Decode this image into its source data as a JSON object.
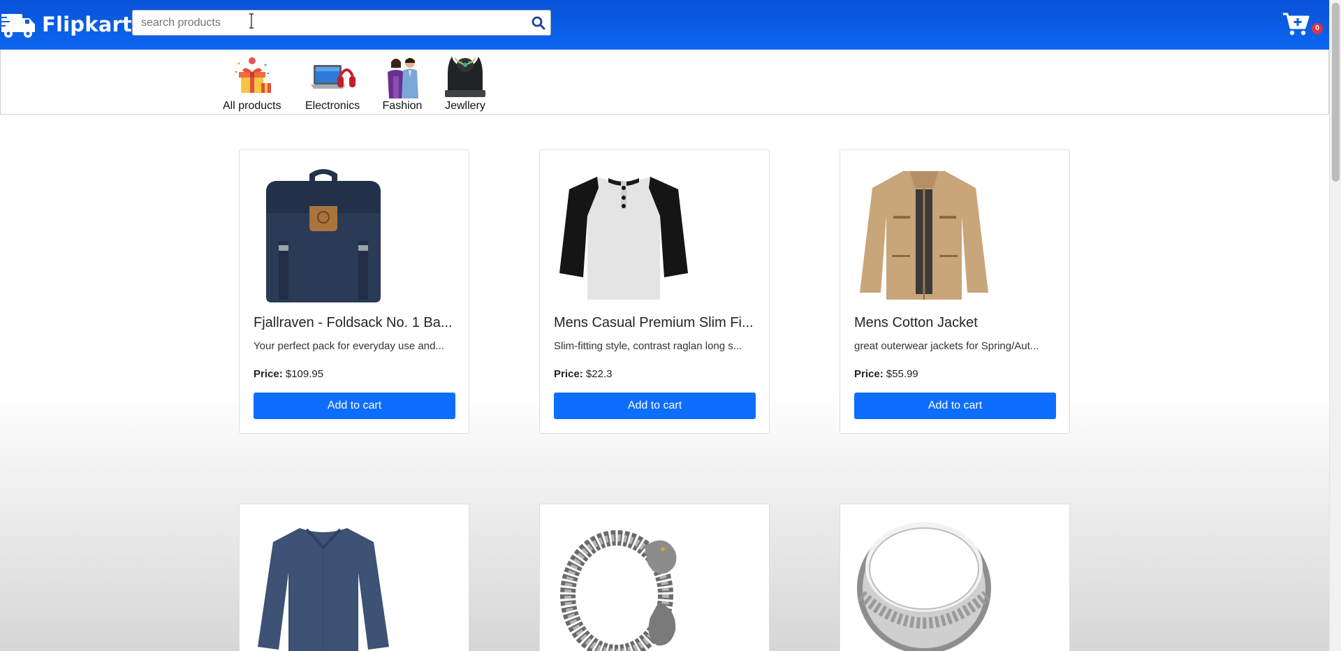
{
  "header": {
    "logo_text": "Flipkart",
    "search_placeholder": "search products",
    "cart_count": "0",
    "logo_icon": "truck-icon",
    "search_icon": "search-icon",
    "cart_icon": "cart-plus-icon"
  },
  "categories": [
    {
      "label": "All products",
      "icon": "gift-boxes-image"
    },
    {
      "label": "Electronics",
      "icon": "laptop-headphones-image"
    },
    {
      "label": "Fashion",
      "icon": "couple-fashion-image"
    },
    {
      "label": "Jewllery",
      "icon": "necklace-image"
    }
  ],
  "products": [
    {
      "title": "Fjallraven - Foldsack No. 1 Ba...",
      "desc": "Your perfect pack for everyday use and...",
      "price_label": "Price:",
      "price": "$109.95",
      "button": "Add to cart",
      "image": "backpack-image"
    },
    {
      "title": "Mens Casual Premium Slim Fi...",
      "desc": "Slim-fitting style, contrast raglan long s...",
      "price_label": "Price:",
      "price": "$22.3",
      "button": "Add to cart",
      "image": "raglan-tshirt-image"
    },
    {
      "title": "Mens Cotton Jacket",
      "desc": "great outerwear jackets for Spring/Aut...",
      "price_label": "Price:",
      "price": "$55.99",
      "button": "Add to cart",
      "image": "cotton-jacket-image"
    },
    {
      "image": "long-sleeve-shirt-image"
    },
    {
      "image": "dragon-bracelet-image"
    },
    {
      "image": "silver-ring-image"
    }
  ],
  "colors": {
    "header_blue": "#0b5ee6",
    "button_blue": "#0d6efd",
    "badge_red": "#dc3545"
  }
}
